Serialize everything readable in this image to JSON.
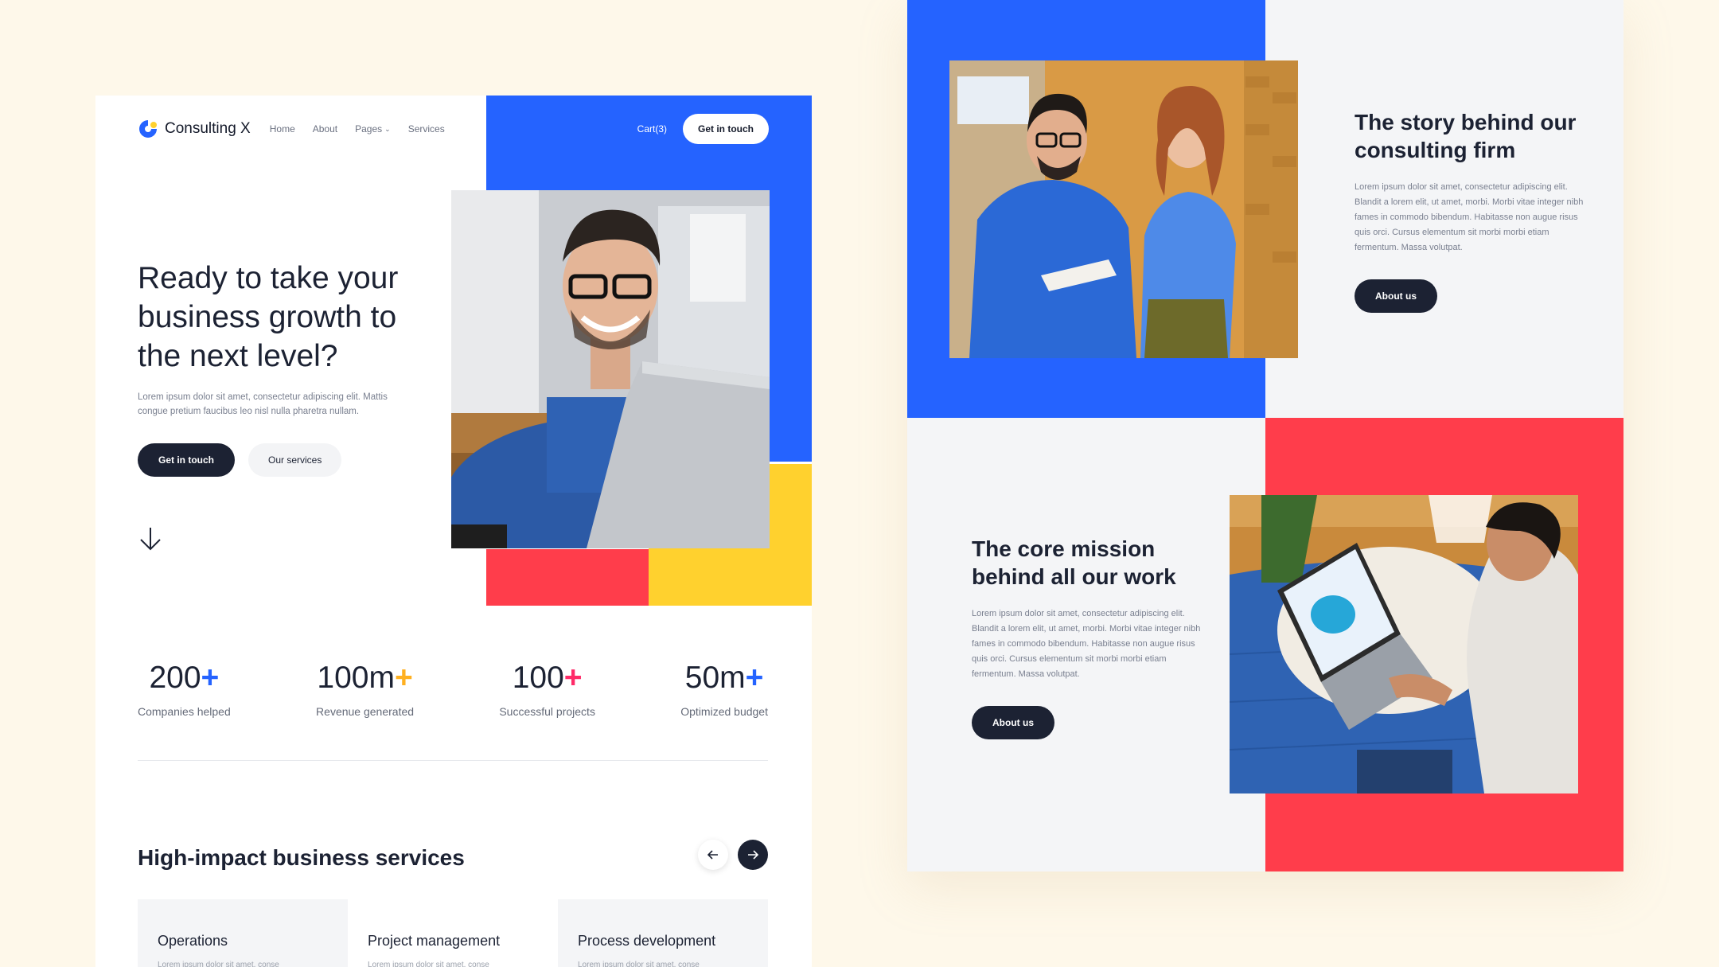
{
  "nav": {
    "brand": "Consulting X",
    "links": [
      "Home",
      "About",
      "Pages",
      "Services"
    ],
    "cart": "Cart(3)",
    "cta": "Get in touch"
  },
  "hero": {
    "title": "Ready to take your business growth to the next level?",
    "subtitle": "Lorem ipsum dolor sit amet, consectetur adipiscing elit. Mattis congue pretium faucibus leo nisl nulla pharetra nullam.",
    "primary_button": "Get in touch",
    "secondary_button": "Our services"
  },
  "stats": [
    {
      "value": "200",
      "plus": "+",
      "plus_color": "#2563ff",
      "label": "Companies helped"
    },
    {
      "value": "100m",
      "plus": "+",
      "plus_color": "#ffb020",
      "label": "Revenue generated"
    },
    {
      "value": "100",
      "plus": "+",
      "plus_color": "#ff2a68",
      "label": "Successful projects"
    },
    {
      "value": "50m",
      "plus": "+",
      "plus_color": "#2563ff",
      "label": "Optimized budget"
    }
  ],
  "services": {
    "title": "High-impact business services",
    "cards": [
      {
        "title": "Operations",
        "text": "Lorem ipsum dolor sit amet, conse"
      },
      {
        "title": "Project management",
        "text": "Lorem ipsum dolor sit amet, conse"
      },
      {
        "title": "Process development",
        "text": "Lorem ipsum dolor sit amet, conse"
      }
    ]
  },
  "story": {
    "title": "The story behind our consulting firm",
    "text": "Lorem ipsum dolor sit amet, consectetur adipiscing elit. Blandit a lorem elit, ut amet, morbi. Morbi vitae integer nibh fames in commodo bibendum. Habitasse non augue risus quis orci. Cursus elementum sit morbi morbi etiam fermentum. Massa volutpat.",
    "button": "About us"
  },
  "mission": {
    "title": "The core mission behind all our work",
    "text": "Lorem ipsum dolor sit amet, consectetur adipiscing elit. Blandit a lorem elit, ut amet, morbi. Morbi vitae integer nibh fames in commodo bibendum. Habitasse non augue risus quis orci. Cursus elementum sit morbi morbi etiam fermentum. Massa volutpat.",
    "button": "About us"
  },
  "colors": {
    "background": "#fef8ea",
    "blue": "#2563ff",
    "red": "#ff3d4b",
    "yellow": "#ffd12e",
    "dark": "#1c2233"
  }
}
